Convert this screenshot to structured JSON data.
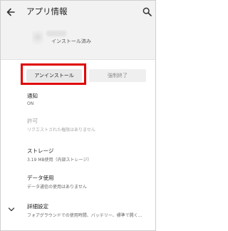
{
  "appbar": {
    "title": "アプリ情報",
    "back_icon": "arrow-left-icon",
    "search_icon": "search-icon"
  },
  "app": {
    "status": "インストール済み"
  },
  "buttons": {
    "uninstall_label": "アンインストール",
    "force_stop_label": "強制終了"
  },
  "settings": {
    "notifications": {
      "title": "通知",
      "subtitle": "ON"
    },
    "permissions": {
      "title": "許可",
      "subtitle": "リクエストされた権限はありません"
    },
    "storage": {
      "title": "ストレージ",
      "subtitle": "3.19 MB使用（内部ストレージ）"
    },
    "data_usage": {
      "title": "データ使用",
      "subtitle": "データ通信の使用はありません"
    },
    "advanced": {
      "title": "詳細設定",
      "subtitle": "フォアグラウンドでの使用時間、バッテリー、標準で開く..."
    }
  },
  "colors": {
    "highlight": "#e00000",
    "appbar_bg": "#f2f2f2"
  }
}
